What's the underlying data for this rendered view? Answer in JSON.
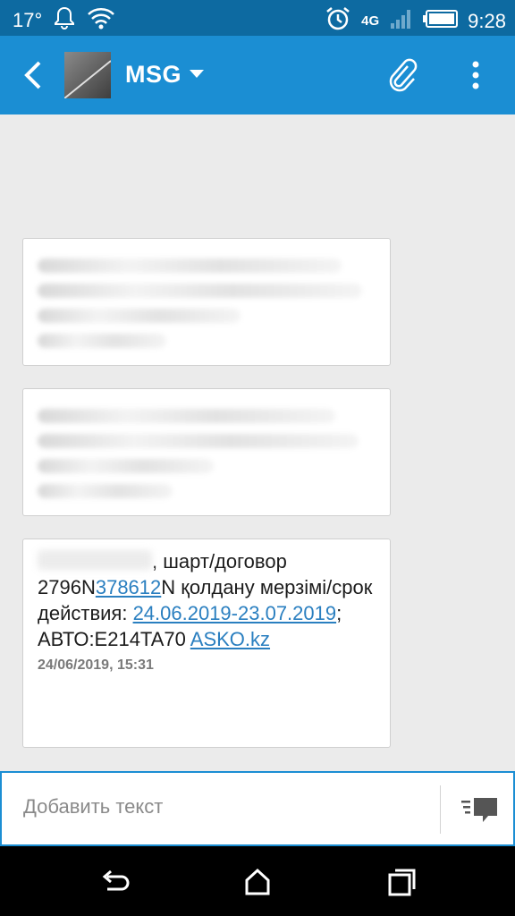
{
  "status_bar": {
    "temperature": "17°",
    "network": "4G",
    "time": "9:28",
    "icons": [
      "bell-icon",
      "wifi-icon",
      "alarm-icon",
      "signal-icon",
      "battery-icon"
    ]
  },
  "app_bar": {
    "title": "MSG",
    "icons": [
      "back-arrow-icon",
      "chevron-down-icon",
      "paperclip-icon",
      "more-vert-icon"
    ]
  },
  "messages": [
    {
      "redacted": true
    },
    {
      "redacted": true
    },
    {
      "text_part1": ", шарт/договор 2796N",
      "text_link1": "378612",
      "text_part2": "N қолдану мерзімі/срок действия: ",
      "text_link2": "24.06.2019-23.07.2019",
      "text_part3": "; АВТО:E214TA70 ",
      "text_link3": "ASKO.kz",
      "time": "24/06/2019, 15:31"
    }
  ],
  "compose": {
    "placeholder": "Добавить текст",
    "send_icon": "send-message-icon"
  },
  "nav_bar": {
    "icons": [
      "back-nav-icon",
      "home-nav-icon",
      "recents-nav-icon"
    ]
  },
  "colors": {
    "status_bar": "#0d6aa1",
    "app_bar": "#1b8ed3",
    "background": "#ebebeb",
    "link": "#2a7fc0"
  }
}
